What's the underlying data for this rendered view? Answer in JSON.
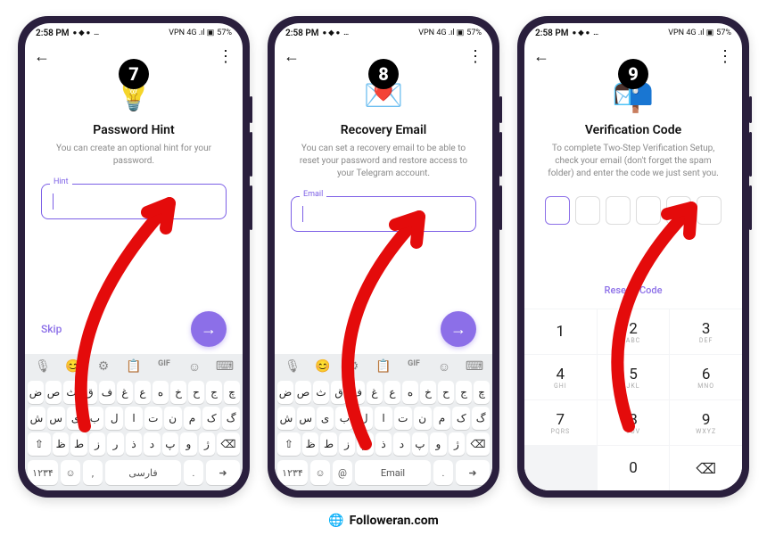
{
  "status": {
    "time": "2:58 PM",
    "battery_pct": "57%",
    "indicators": "VPN 4G .ıl ▣"
  },
  "steps": [
    {
      "badge": "7",
      "title": "Password Hint",
      "desc": "You can create an optional hint for your password.",
      "field_label": "Hint",
      "skip_label": "Skip"
    },
    {
      "badge": "8",
      "title": "Recovery Email",
      "desc": "You can set a recovery email to be able to reset your password and restore access to your Telegram account.",
      "field_label": "Email"
    },
    {
      "badge": "9",
      "title": "Verification Code",
      "desc": "To complete Two-Step Verification Setup, check your email (don't forget the spam folder) and enter the code we just sent you.",
      "resend_label": "Resend Code"
    }
  ],
  "keyboard": {
    "rows": [
      [
        "ض",
        "ص",
        "ث",
        "ق",
        "ف",
        "غ",
        "ع",
        "ه",
        "خ",
        "ح",
        "ج",
        "چ"
      ],
      [
        "ش",
        "س",
        "ی",
        "ب",
        "ل",
        "ا",
        "ت",
        "ن",
        "م",
        "ک",
        "گ"
      ],
      [
        "ظ",
        "ط",
        "ز",
        "ر",
        "ذ",
        "د",
        "پ",
        "و",
        "ژ"
      ]
    ],
    "num_label": "۱۲۳۴",
    "space_label": "فارسی",
    "toprow_icons": [
      "🎙",
      "😊",
      "⚙",
      "📋",
      "GIF",
      "☺",
      "⌨"
    ]
  },
  "numpad": {
    "keys": [
      {
        "n": "1",
        "s": ""
      },
      {
        "n": "2",
        "s": "ABC"
      },
      {
        "n": "3",
        "s": "DEF"
      },
      {
        "n": "4",
        "s": "GHI"
      },
      {
        "n": "5",
        "s": "JKL"
      },
      {
        "n": "6",
        "s": "MNO"
      },
      {
        "n": "7",
        "s": "PQRS"
      },
      {
        "n": "8",
        "s": "TUV"
      },
      {
        "n": "9",
        "s": "WXYZ"
      },
      {
        "n": "",
        "s": ""
      },
      {
        "n": "0",
        "s": ""
      },
      {
        "n": "⌫",
        "s": ""
      }
    ]
  },
  "brand": "Followeran.com"
}
